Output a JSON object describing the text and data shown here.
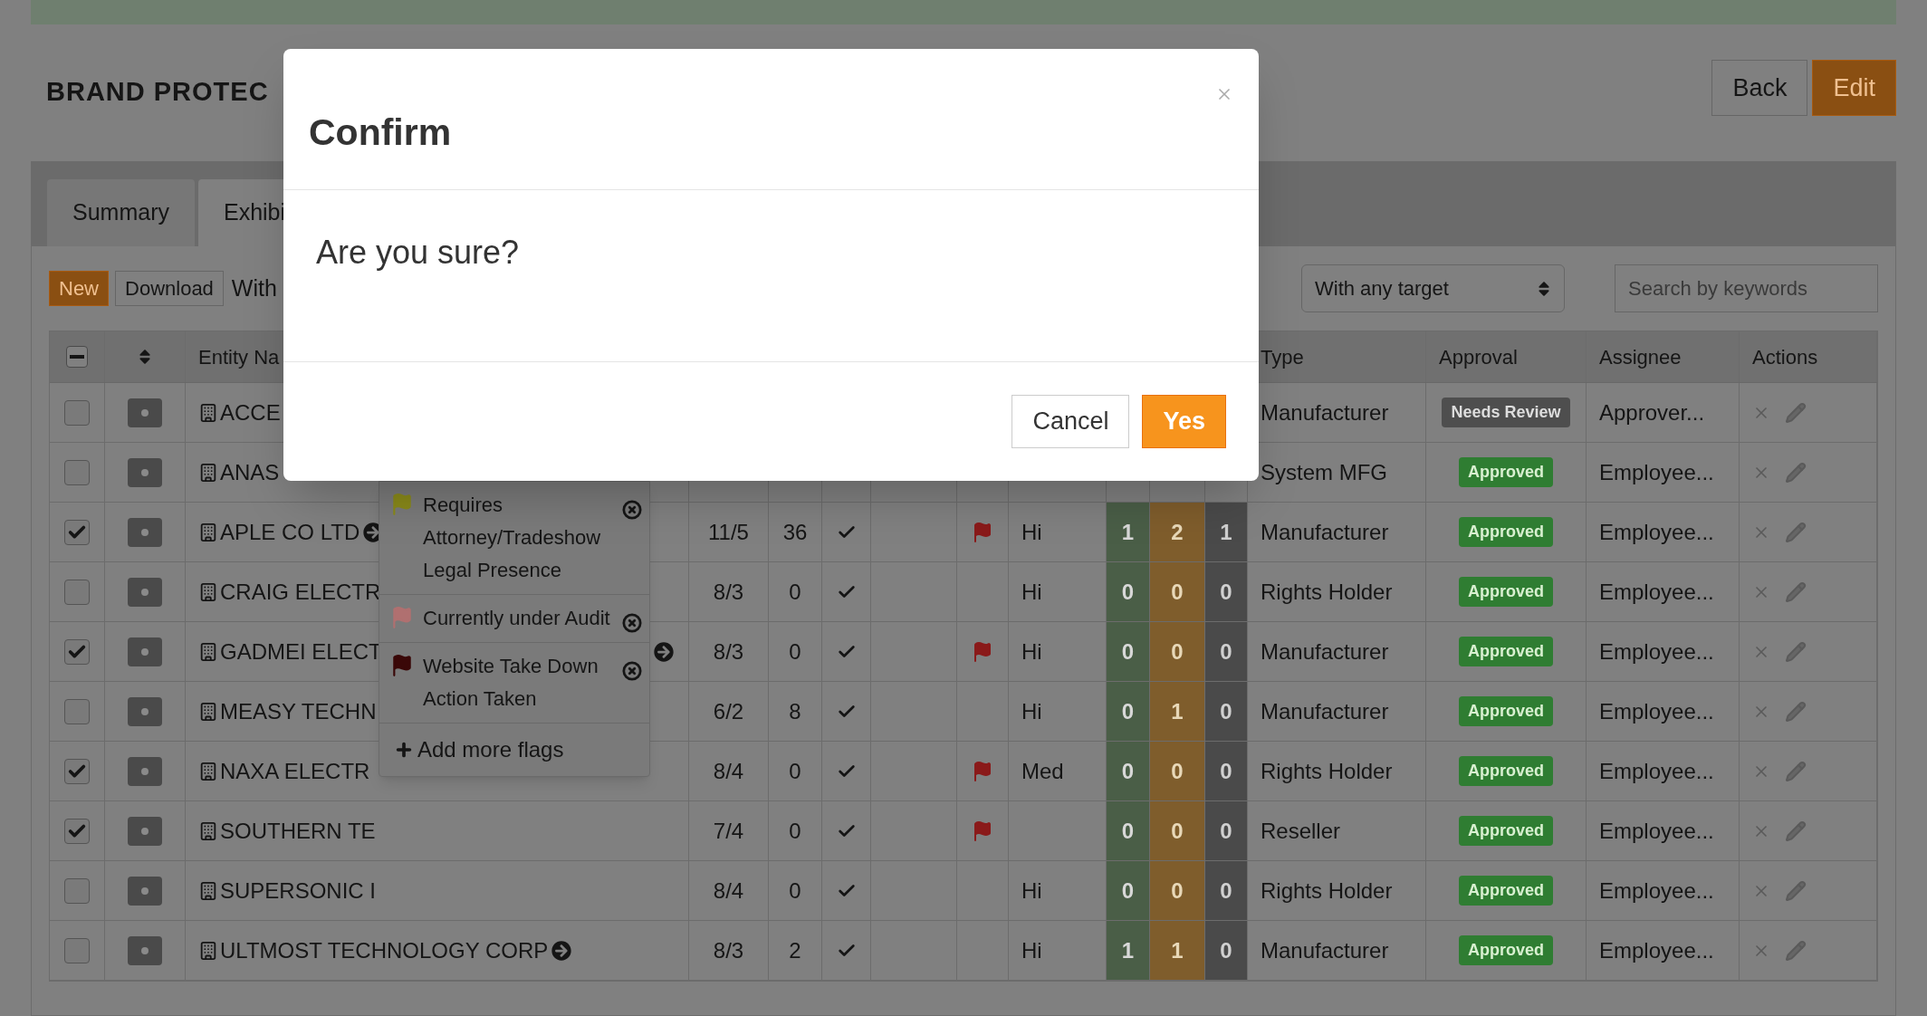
{
  "page": {
    "title": "BRAND PROTEC",
    "buttons": [
      {
        "label": "Back",
        "kind": "default"
      },
      {
        "label": "Edit",
        "kind": "primary"
      }
    ]
  },
  "tabs": [
    {
      "label": "Summary",
      "selected": false
    },
    {
      "label": "Exhibi",
      "selected": true
    }
  ],
  "toolbar": {
    "buttons": [
      {
        "label": "New",
        "kind": "primary"
      },
      {
        "label": "Download",
        "kind": "default"
      }
    ],
    "filter_label": "With",
    "target_select": {
      "value": "With any target"
    },
    "search": {
      "placeholder": "Search by keywords"
    }
  },
  "table": {
    "select_all": {
      "indeterminate": true
    },
    "columns": {
      "entity": "Entity Na",
      "type": "Type",
      "approval": "Approval",
      "assignee": "Assignee",
      "actions": "Actions"
    },
    "rows": [
      {
        "checked": false,
        "entity": "ACCE",
        "type": "Manufacturer",
        "approval": {
          "label": "Needs Review",
          "kind": "needs_review"
        },
        "assignee": "Approver..."
      },
      {
        "checked": false,
        "entity": "ANAS",
        "type": "System MFG",
        "approval": {
          "label": "Approved",
          "kind": "approved"
        },
        "assignee": "Employee..."
      },
      {
        "checked": true,
        "entity": "APLE CO LTD",
        "arrow": true,
        "arrow_at_end": false,
        "date": "11/5",
        "count": "36",
        "done": true,
        "flagged": true,
        "priority": "Hi",
        "counts": [
          "1",
          "2",
          "1"
        ],
        "type": "Manufacturer",
        "approval": {
          "label": "Approved",
          "kind": "approved"
        },
        "assignee": "Employee..."
      },
      {
        "checked": false,
        "entity": "CRAIG ELECTR",
        "date": "8/3",
        "count": "0",
        "done": true,
        "flagged": false,
        "priority": "Hi",
        "counts": [
          "0",
          "0",
          "0"
        ],
        "type": "Rights Holder",
        "approval": {
          "label": "Approved",
          "kind": "approved"
        },
        "assignee": "Employee..."
      },
      {
        "checked": true,
        "entity": "GADMEI ELECT",
        "arrow": true,
        "arrow_at_end": true,
        "date": "8/3",
        "count": "0",
        "done": true,
        "flagged": true,
        "priority": "Hi",
        "counts": [
          "0",
          "0",
          "0"
        ],
        "type": "Manufacturer",
        "approval": {
          "label": "Approved",
          "kind": "approved"
        },
        "assignee": "Employee..."
      },
      {
        "checked": false,
        "entity": "MEASY TECHN",
        "date": "6/2",
        "count": "8",
        "done": true,
        "flagged": false,
        "priority": "Hi",
        "counts": [
          "0",
          "1",
          "0"
        ],
        "type": "Manufacturer",
        "approval": {
          "label": "Approved",
          "kind": "approved"
        },
        "assignee": "Employee..."
      },
      {
        "checked": true,
        "entity": "NAXA ELECTR",
        "date": "8/4",
        "count": "0",
        "done": true,
        "flagged": true,
        "priority": "Med",
        "counts": [
          "0",
          "0",
          "0"
        ],
        "type": "Rights Holder",
        "approval": {
          "label": "Approved",
          "kind": "approved"
        },
        "assignee": "Employee..."
      },
      {
        "checked": true,
        "entity": "SOUTHERN TE",
        "date": "7/4",
        "count": "0",
        "done": true,
        "flagged": true,
        "counts": [
          "0",
          "0",
          "0"
        ],
        "type": "Reseller",
        "approval": {
          "label": "Approved",
          "kind": "approved"
        },
        "assignee": "Employee..."
      },
      {
        "checked": false,
        "entity": "SUPERSONIC I",
        "date": "8/4",
        "count": "0",
        "done": true,
        "flagged": false,
        "priority": "Hi",
        "counts": [
          "0",
          "0",
          "0"
        ],
        "type": "Rights Holder",
        "approval": {
          "label": "Approved",
          "kind": "approved"
        },
        "assignee": "Employee..."
      },
      {
        "checked": false,
        "entity": "ULTMOST TECHNOLOGY CORP",
        "arrow": true,
        "arrow_at_end": false,
        "date": "8/3",
        "count": "2",
        "done": true,
        "flagged": false,
        "priority": "Hi",
        "counts": [
          "1",
          "1",
          "0"
        ],
        "type": "Manufacturer",
        "approval": {
          "label": "Approved",
          "kind": "approved"
        },
        "assignee": "Employee..."
      }
    ]
  },
  "flag_popover": {
    "flags": [
      {
        "label": "Requires Attorney/Tradeshow Legal Presence",
        "color": "#8a8a1a"
      },
      {
        "label": "Currently under Audit",
        "color": "#b07070"
      },
      {
        "label": "Website Take Down Action Taken",
        "color": "#3a0808"
      }
    ],
    "add_label": "Add more flags"
  },
  "modal": {
    "title": "Confirm",
    "message": "Are you sure?",
    "buttons": [
      {
        "label": "Cancel",
        "kind": "default"
      },
      {
        "label": "Yes",
        "kind": "primary"
      }
    ]
  }
}
